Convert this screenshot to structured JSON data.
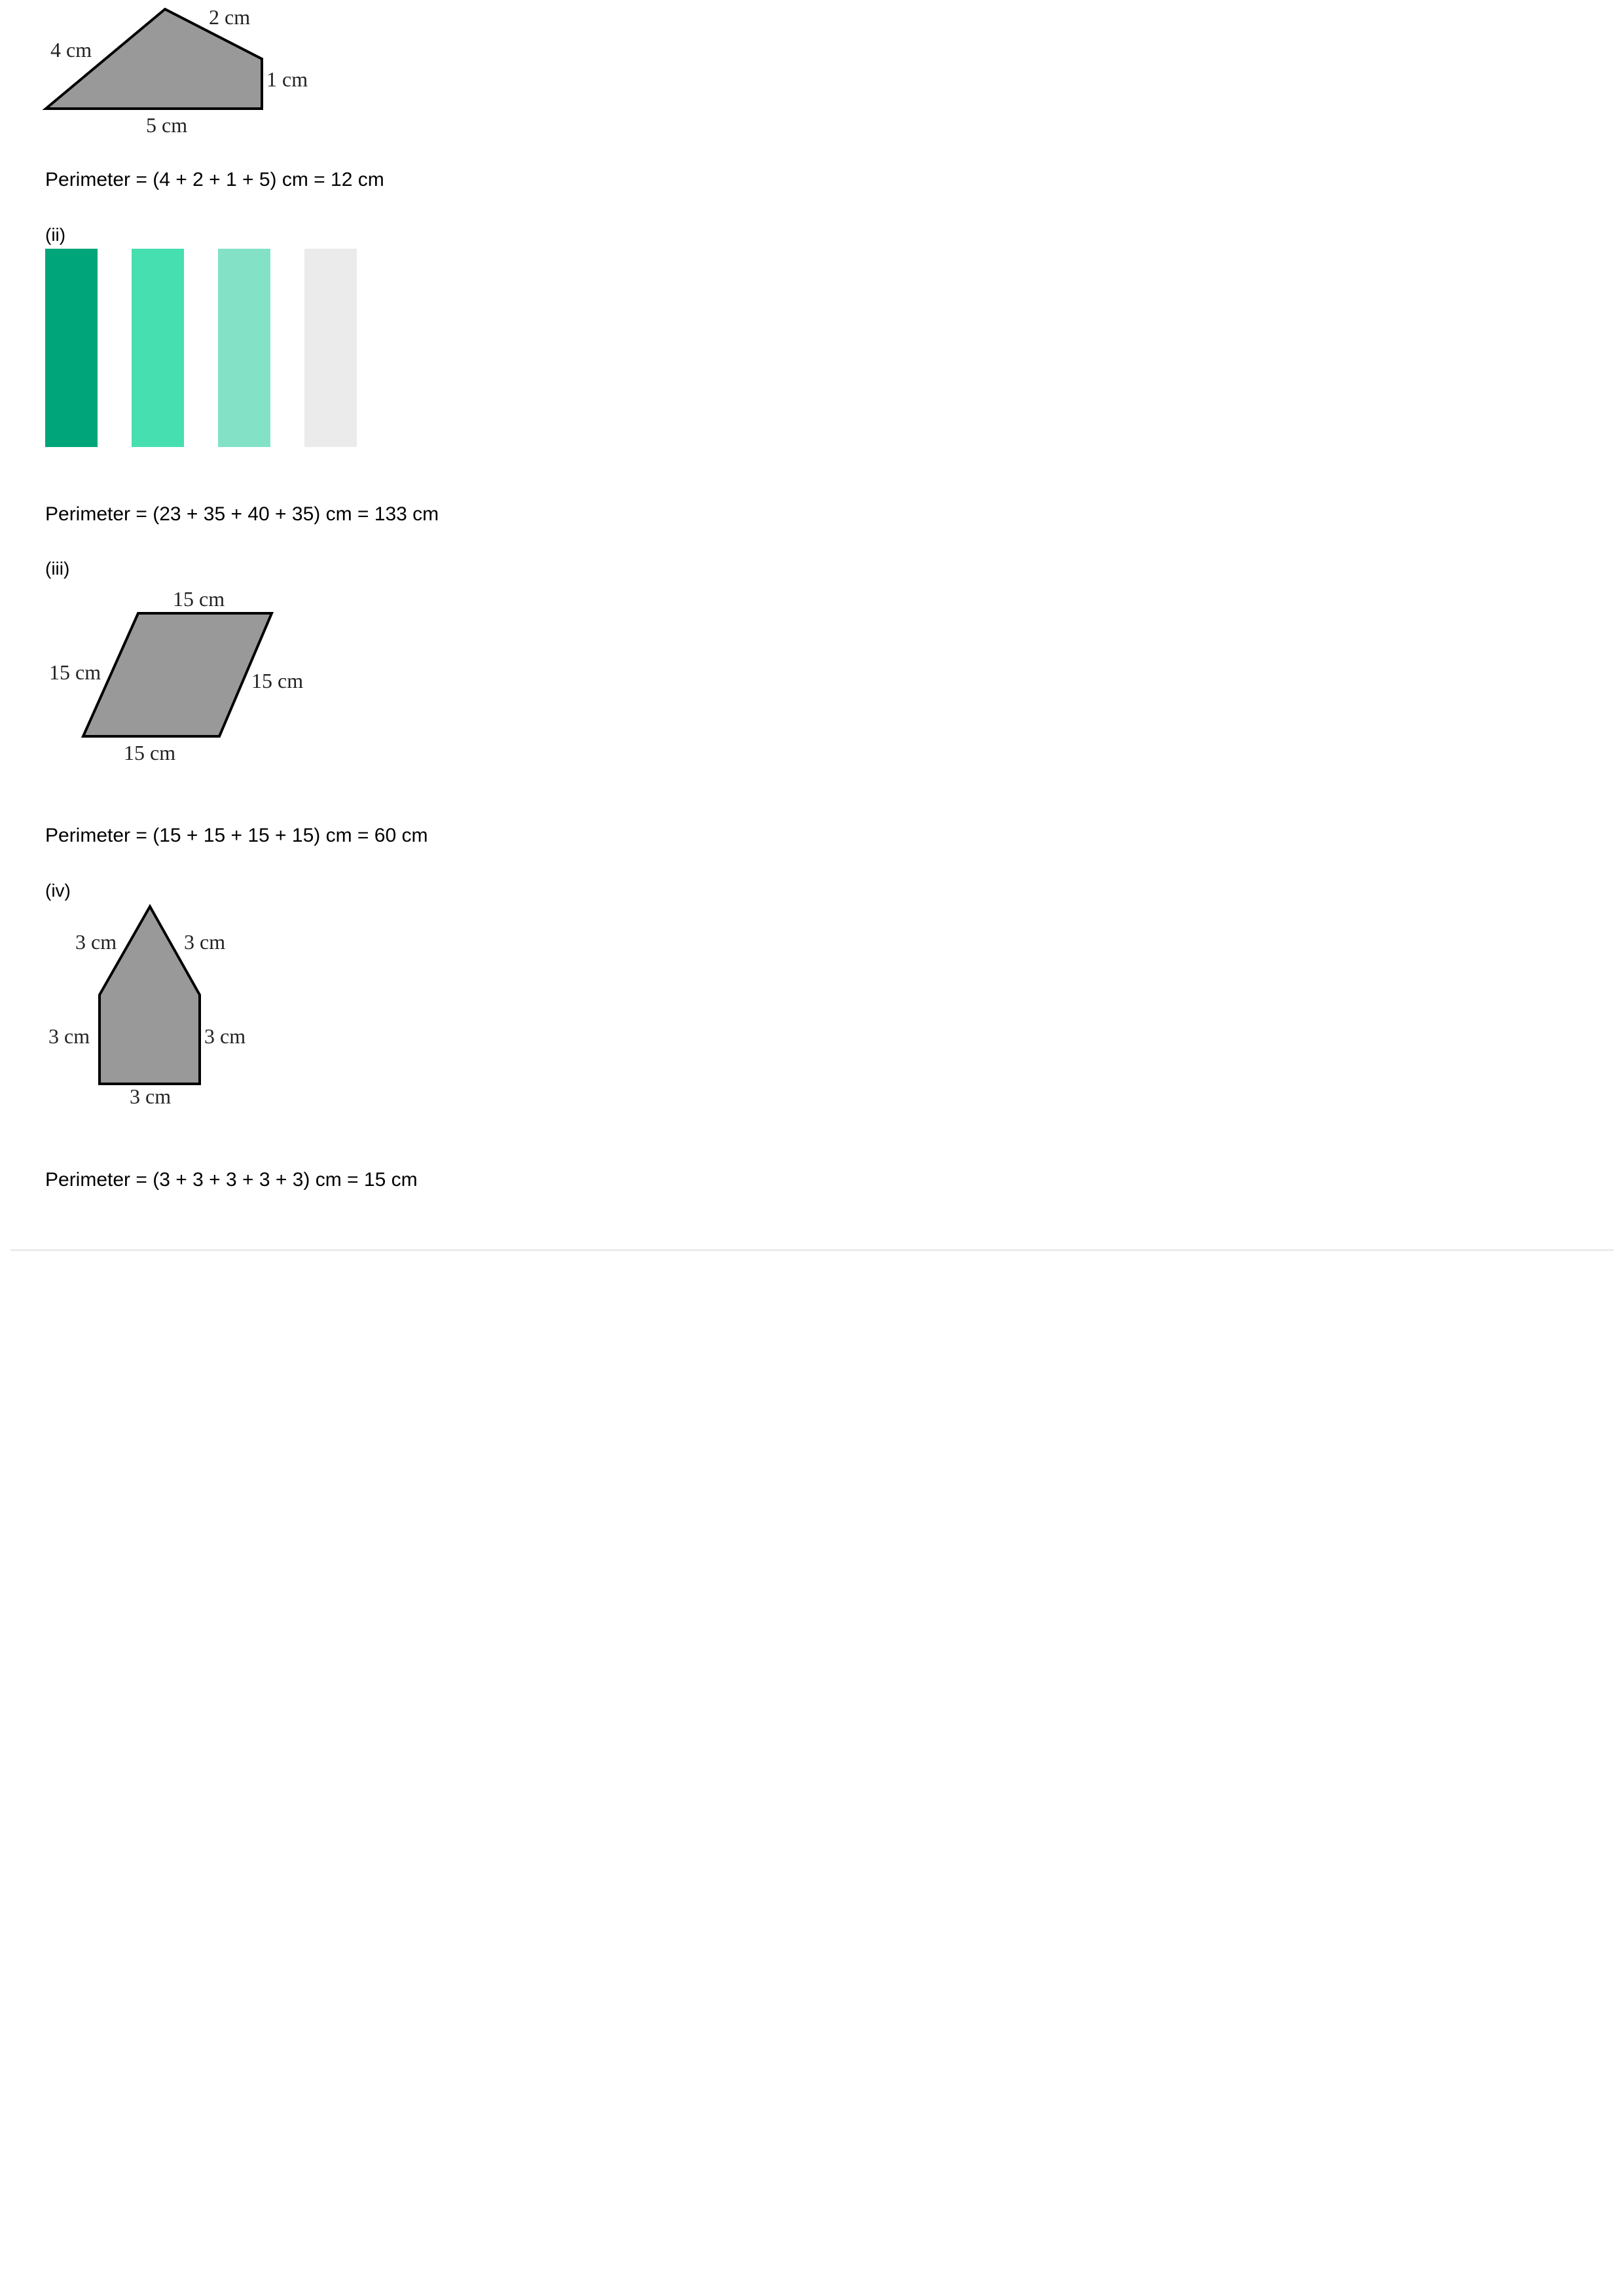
{
  "part_i": {
    "labels": {
      "left": "4 cm",
      "top": "2 cm",
      "right": "1 cm",
      "bottom": "5 cm"
    },
    "perimeter": "Perimeter = (4 + 2 + 1 + 5) cm = 12 cm"
  },
  "part_ii": {
    "label": "(ii)",
    "bar_colors": [
      "#00a67a",
      "#46dfb0",
      "#83e2c6",
      "#ebebeb"
    ],
    "perimeter": "Perimeter = (23 + 35 + 40 + 35) cm = 133 cm"
  },
  "part_iii": {
    "label": "(iii)",
    "labels": {
      "top": "15 cm",
      "left": "15 cm",
      "right": "15 cm",
      "bottom": "15 cm"
    },
    "perimeter": "Perimeter = (15 + 15 + 15 + 15) cm = 60 cm"
  },
  "part_iv": {
    "label": "(iv)",
    "labels": {
      "roof_left": "3 cm",
      "roof_right": "3 cm",
      "left": "3 cm",
      "right": "3 cm",
      "bottom": "3 cm"
    },
    "perimeter": "Perimeter = (3 + 3 + 3 + 3 + 3) cm = 15 cm"
  },
  "colors": {
    "shape_fill": "#999999",
    "divider": "#e4e4e4"
  }
}
